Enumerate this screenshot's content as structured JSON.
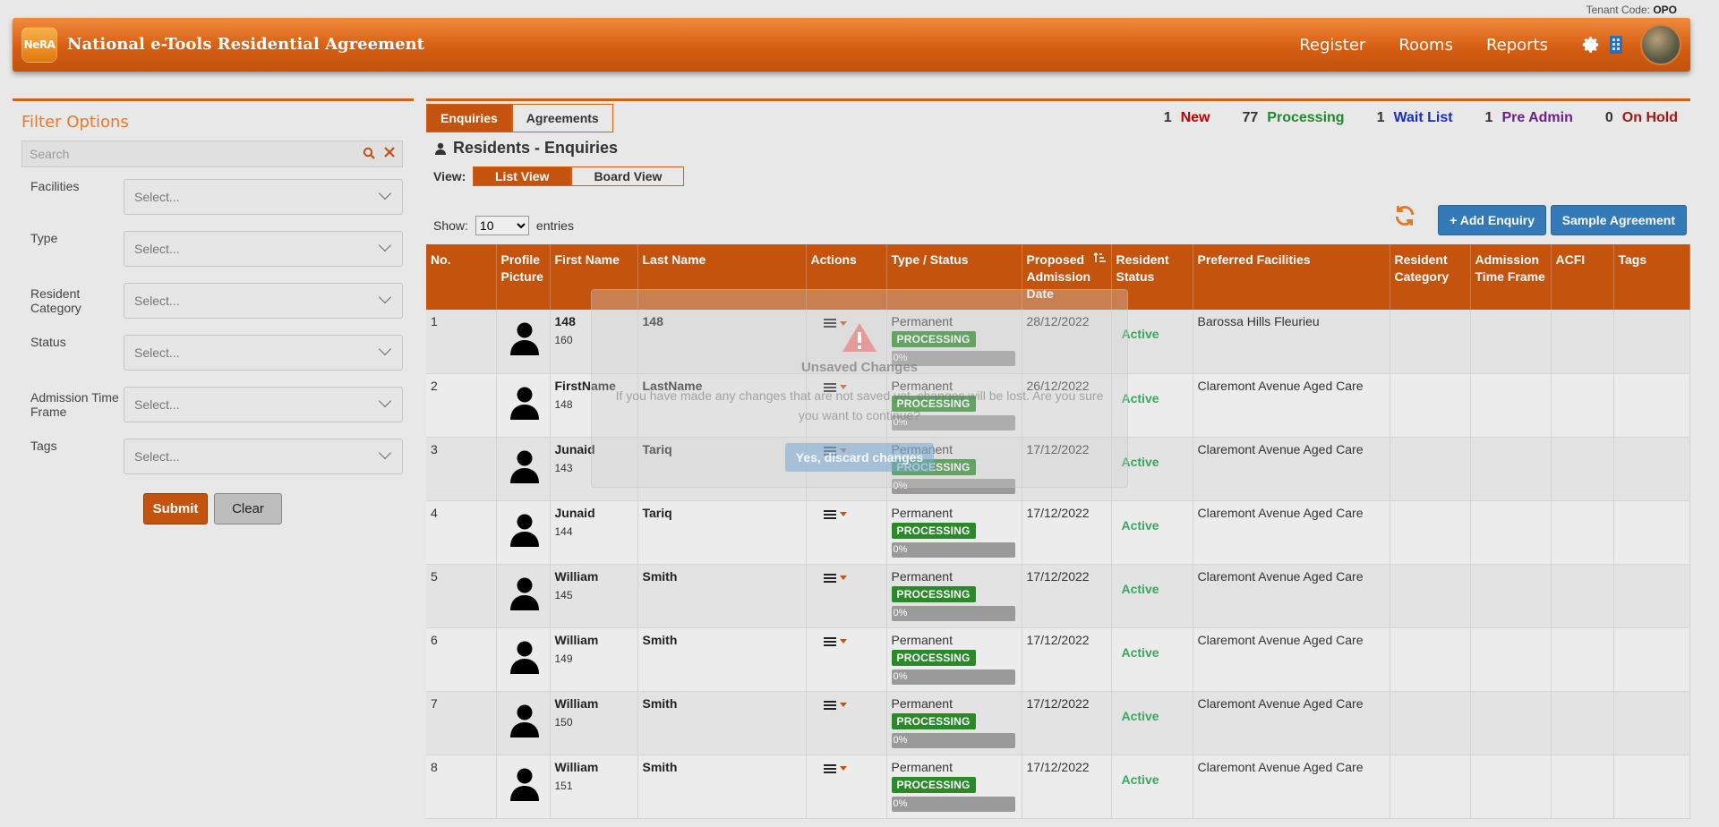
{
  "tenant": {
    "label": "Tenant Code:",
    "code": "OPO"
  },
  "header": {
    "logo_text": "NeRA",
    "title": "National e-Tools Residential Agreement",
    "nav": [
      "Register",
      "Rooms",
      "Reports"
    ]
  },
  "filter": {
    "title": "Filter Options",
    "search_placeholder": "Search",
    "fields": [
      {
        "label": "Facilities",
        "placeholder": "Select..."
      },
      {
        "label": "Type",
        "placeholder": "Select..."
      },
      {
        "label": "Resident Category",
        "placeholder": "Select..."
      },
      {
        "label": "Status",
        "placeholder": "Select..."
      },
      {
        "label": "Admission Time Frame",
        "placeholder": "Select..."
      },
      {
        "label": "Tags",
        "placeholder": "Select..."
      }
    ],
    "submit_label": "Submit",
    "clear_label": "Clear"
  },
  "main": {
    "tabs": [
      "Enquiries",
      "Agreements"
    ],
    "counts": [
      {
        "n": "1",
        "label": "New",
        "color": "#c00000"
      },
      {
        "n": "77",
        "label": "Processing",
        "color": "#1e8a2c"
      },
      {
        "n": "1",
        "label": "Wait List",
        "color": "#1a2fc0"
      },
      {
        "n": "1",
        "label": "Pre Admin",
        "color": "#6b1f8a"
      },
      {
        "n": "0",
        "label": "On Hold",
        "color": "#a01818"
      }
    ],
    "section_title": "Residents - Enquiries",
    "view_label": "View:",
    "view_tabs": [
      "List View",
      "Board View"
    ],
    "show_label": "Show:",
    "show_value": "10",
    "entries_label": "entries",
    "add_button": "+ Add Enquiry",
    "sample_button": "Sample Agreement",
    "columns": [
      "No.",
      "Profile Picture",
      "First Name",
      "Last Name",
      "Actions",
      "Type / Status",
      "Proposed Admission Date",
      "Resident Status",
      "Preferred Facilities",
      "Resident Category",
      "Admission Time Frame",
      "ACFI",
      "Tags"
    ],
    "rows": [
      {
        "no": "1",
        "first": "148",
        "id": "160",
        "last": "148",
        "type": "Permanent",
        "status": "PROCESSING",
        "progress": "0%",
        "date": "28/12/2022",
        "res_status": "Active",
        "facility": "Barossa Hills Fleurieu"
      },
      {
        "no": "2",
        "first": "FirstName",
        "id": "148",
        "last": "LastName",
        "type": "Permanent",
        "status": "PROCESSING",
        "progress": "0%",
        "date": "26/12/2022",
        "res_status": "Active",
        "facility": "Claremont Avenue Aged Care"
      },
      {
        "no": "3",
        "first": "Junaid",
        "id": "143",
        "last": "Tariq",
        "type": "Permanent",
        "status": "PROCESSING",
        "progress": "0%",
        "date": "17/12/2022",
        "res_status": "Active",
        "facility": "Claremont Avenue Aged Care"
      },
      {
        "no": "4",
        "first": "Junaid",
        "id": "144",
        "last": "Tariq",
        "type": "Permanent",
        "status": "PROCESSING",
        "progress": "0%",
        "date": "17/12/2022",
        "res_status": "Active",
        "facility": "Claremont Avenue Aged Care"
      },
      {
        "no": "5",
        "first": "William",
        "id": "145",
        "last": "Smith",
        "type": "Permanent",
        "status": "PROCESSING",
        "progress": "0%",
        "date": "17/12/2022",
        "res_status": "Active",
        "facility": "Claremont Avenue Aged Care"
      },
      {
        "no": "6",
        "first": "William",
        "id": "149",
        "last": "Smith",
        "type": "Permanent",
        "status": "PROCESSING",
        "progress": "0%",
        "date": "17/12/2022",
        "res_status": "Active",
        "facility": "Claremont Avenue Aged Care"
      },
      {
        "no": "7",
        "first": "William",
        "id": "150",
        "last": "Smith",
        "type": "Permanent",
        "status": "PROCESSING",
        "progress": "0%",
        "date": "17/12/2022",
        "res_status": "Active",
        "facility": "Claremont Avenue Aged Care"
      },
      {
        "no": "8",
        "first": "William",
        "id": "151",
        "last": "Smith",
        "type": "Permanent",
        "status": "PROCESSING",
        "progress": "0%",
        "date": "17/12/2022",
        "res_status": "Active",
        "facility": "Claremont Avenue Aged Care"
      }
    ]
  },
  "modal": {
    "title": "Unsaved Changes",
    "message": "If you have made any changes that are not saved yet, changes will be lost. Are you sure you want to continue?",
    "confirm_label": "Yes, discard changes"
  },
  "colors": {
    "brand": "#c4540d",
    "accent_blue": "#337ab7",
    "processing_green": "#2a8a2a",
    "active_green": "#3ba55d"
  }
}
